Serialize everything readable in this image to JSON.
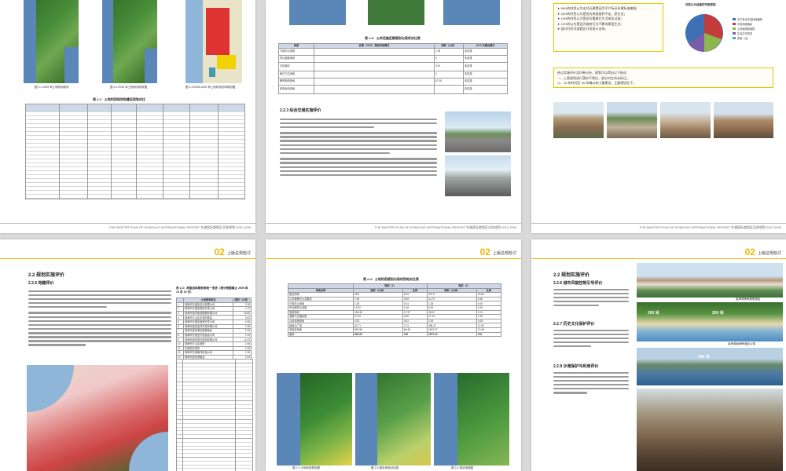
{
  "footer": "THE MASTER PLAN OF DONGLAO INTERNATIONAL RESORT  东澳国际度假区总体规划 2011-2030",
  "page1": {
    "fig_captions": [
      "图 2-1 2009 年土地利用现状",
      "图 2-2 2010 年土地利用现状图",
      "图 2-3 2006-2020 年土地利用总体规划图"
    ],
    "table_title": "表 2-1：土地利用现状和建设用地对比"
  },
  "page2": {
    "table_title": "表 2-2：公共设施近期规划与现状对比表",
    "table_headers": [
      "类型",
      "近期（2015）规划布局情况",
      "面积（公顷）",
      "2010 年建设情况"
    ],
    "table_rows": [
      [
        "行政办公用地",
        "",
        "1.28",
        "未实施"
      ],
      [
        "商业金融用地",
        "",
        "0",
        "未实施"
      ],
      [
        "文化娱乐",
        "",
        "3.52",
        "未实施"
      ],
      [
        "医疗卫生用地",
        "",
        "0",
        "未实施"
      ],
      [
        "教育科研用地",
        "",
        "67.38",
        "未实施"
      ],
      [
        "体育运动用地",
        "",
        "",
        "未实施"
      ]
    ],
    "section": "2.2.3  综合交通实施评价"
  },
  "page3": {
    "chart_title": "村民认为迫建的可能原因",
    "legend": [
      "平户拆迁补偿标准偏低",
      "补偿标准偏高",
      "土地使用权保障",
      "生活方式改变",
      "其他（注）"
    ],
    "bullets": [
      "➤ 66%的村民认为支付迁建是因为平户拆迁补偿标准偏低；",
      "➤ 26%的村民认为是因为承接面积不足，愿迁出；",
      "➤ 18%的村民认为是因为重建后生活成本过高；",
      "➤ 10%的认为是因为政府行为不影响原居生活；",
      "➤ 部分村民对度假区开发表示支持。"
    ],
    "note": [
      "经过实施评价及问卷分析，规划可以得出以下结论：",
      "一、上版规划进行落实不到位，部分村庄尚未拆迁；",
      "二、15 年时间至 05 年确以有小量建设，主要原因在于。"
    ]
  },
  "page4": {
    "chapter_num": "02",
    "chapter_title": "上版总规检讨",
    "section": "2.2  规划实施评价",
    "subsection": "2.2.5  地籍评价",
    "table_title": "表 2-3：原版总体规划用地一览表（统计数据截止 2009 年 12 月 30 日）",
    "table_headers": [
      "",
      "土地使用单位",
      "面积（公顷）"
    ],
    "table_rows": [
      [
        "1",
        "珠海市东澳岛农业有限公司",
        "3.28"
      ],
      [
        "2",
        "珠海市东澳岛旅游开发公司",
        "1.12"
      ],
      [
        "3",
        "珠海东澳湾旅游度假有限公司",
        "16.80"
      ],
      [
        "4",
        "珠海市万山区东澳村委会",
        "0.52"
      ],
      [
        "5",
        "珠海市东澳岛渔港开发公司",
        "4.65"
      ],
      [
        "6",
        "珠海东澳岛蓝湾开发有限公司",
        "2.38"
      ],
      [
        "7",
        "珠海东澳岛海岛度假酒店",
        "5.16"
      ],
      [
        "8",
        "珠海市东澳岛开发建设公司",
        "7.49"
      ],
      [
        "9",
        "珠海东澳岛观光旅游有限公司",
        "12.03"
      ],
      [
        "10",
        "珠海市万山区政府",
        "1.86"
      ],
      [
        "11",
        "东澳岛供电所",
        "0.28"
      ],
      [
        "12",
        "珠海市东澳海洋科技公司",
        "2.15"
      ],
      [
        "13",
        "珠海东澳岛游艇会",
        "3.04"
      ],
      [
        "14",
        "中国移动珠海分公司",
        "0.12"
      ],
      [
        "15",
        "中国电信珠海分公司",
        "0.08"
      ]
    ]
  },
  "page5": {
    "chapter_num": "02",
    "chapter_title": "上版总规检讨",
    "table_title": "表 2-4：土地利用规划与现状用地对比表",
    "table_headers": [
      "用地名称",
      "面积（公顷）",
      "比例",
      "面积（公顷）",
      "比例"
    ],
    "table_group_headers": [
      "",
      "规划（1）",
      "现状（2）"
    ],
    "table_rows": [
      [
        "居住用地",
        "58.5",
        "6.54",
        "407.5",
        "15.84"
      ],
      [
        "公共管理与公共服务",
        "7.45",
        "0.83",
        "11.73",
        "0.46"
      ],
      [
        "行政办公用地",
        "1.28",
        "0.14",
        "1.28",
        "0.05"
      ],
      [
        "商业服务业设施",
        "13.20",
        "1.48",
        "6.32",
        "0.25"
      ],
      [
        "旅游用地",
        "155.45",
        "17.37",
        "26.02",
        "1.01"
      ],
      [
        "道路与交通设施",
        "47.39",
        "5.30",
        "27.15",
        "1.06"
      ],
      [
        "公用设施用地",
        "4.52",
        "0.51",
        "2.18",
        "0.08"
      ],
      [
        "绿地与广场",
        "62.71",
        "7.01",
        "285.47",
        "11.09"
      ],
      [
        "非建设用地",
        "594.58",
        "66.45",
        "1813.27",
        "70.48"
      ],
      [
        "合计",
        "894.80",
        "100",
        "2572.94",
        "100"
      ]
    ],
    "map_captions": [
      "图 2-4 土地利用规划图",
      "图 2-5 建设用地对比图",
      "图 2-6 现状用地图"
    ]
  },
  "page6": {
    "chapter_num": "02",
    "chapter_title": "上版总规检讨",
    "section": "2.2  规划实施评价",
    "subsections": [
      "2.2.6  城市风貌控制引导评价",
      "2.2.7  历史文化保护评价",
      "2.2.8  沙滩保护与利用评价"
    ],
    "photo_labels": [
      "金海湾海岸度假酒店",
      "金海湾南海畔酒店公寓"
    ],
    "area_labels": [
      "200 米",
      "200 米",
      "240 米"
    ]
  }
}
